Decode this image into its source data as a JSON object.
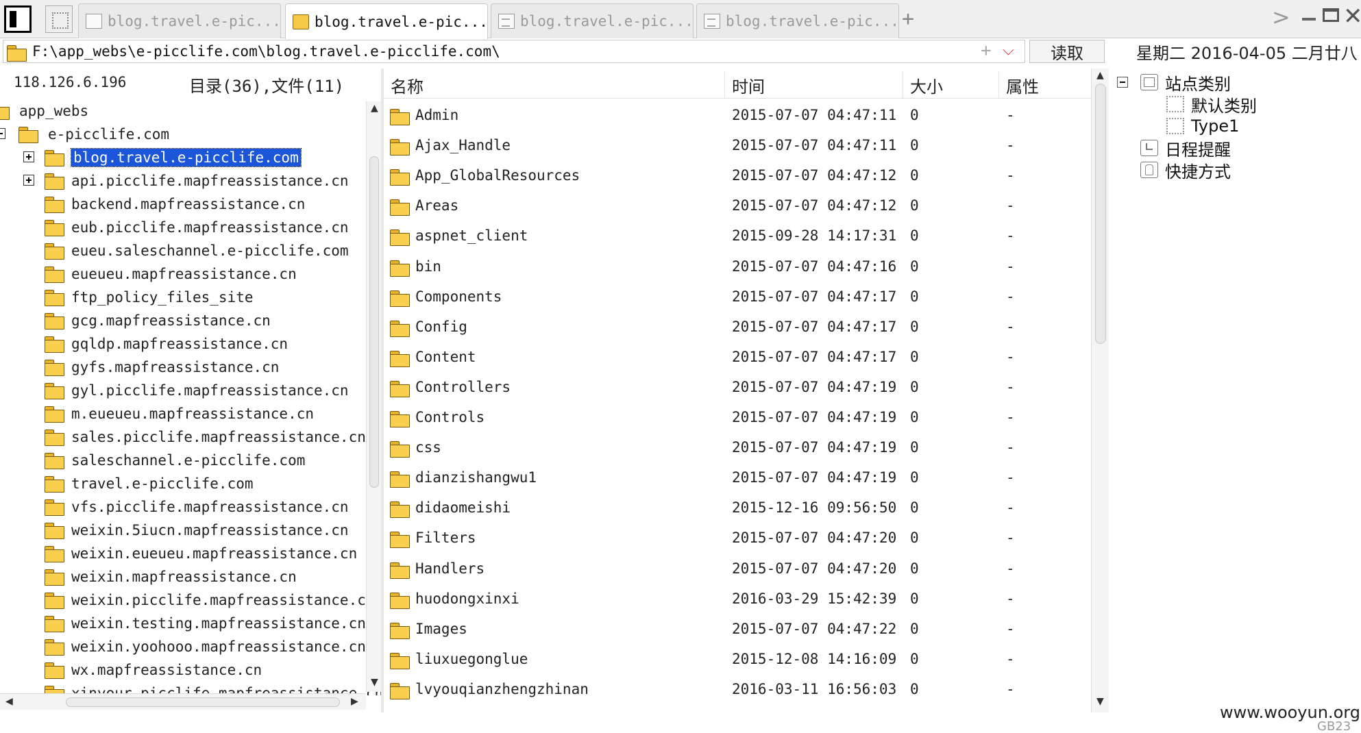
{
  "tabs": [
    {
      "label": "blog.travel.e-pic...",
      "icon": "page-icon",
      "active": false
    },
    {
      "label": "blog.travel.e-pic...",
      "icon": "folder-icon",
      "active": true
    },
    {
      "label": "blog.travel.e-pic...",
      "icon": "document-icon",
      "active": false
    },
    {
      "label": "blog.travel.e-pic...",
      "icon": "document-icon",
      "active": false
    }
  ],
  "toolbar": {
    "add_tab": "+",
    "scroll_tabs": ">",
    "address": "F:\\app_webs\\e-picclife.com\\blog.travel.e-picclife.com\\",
    "address_add": "+",
    "address_dropdown": "⌵",
    "read_button": "读取"
  },
  "window_controls": {
    "close": "✕"
  },
  "status": {
    "ip": "118.126.6.196",
    "dir_count": "目录(36),文件(11)"
  },
  "tree": {
    "root": "app_webs",
    "domain": "e-picclife.com",
    "items": [
      "blog.travel.e-picclife.com",
      "api.picclife.mapfreassistance.cn",
      "backend.mapfreassistance.cn",
      "eub.picclife.mapfreassistance.cn",
      "eueu.saleschannel.e-picclife.com",
      "eueueu.mapfreassistance.cn",
      "ftp_policy_files_site",
      "gcg.mapfreassistance.cn",
      "gqldp.mapfreassistance.cn",
      "gyfs.mapfreassistance.cn",
      "gyl.picclife.mapfreassistance.cn",
      "m.eueueu.mapfreassistance.cn",
      "sales.picclife.mapfreassistance.cn",
      "saleschannel.e-picclife.com",
      "travel.e-picclife.com",
      "vfs.picclife.mapfreassistance.cn",
      "weixin.5iucn.mapfreassistance.cn",
      "weixin.eueueu.mapfreassistance.cn",
      "weixin.mapfreassistance.cn",
      "weixin.picclife.mapfreassistance.cn",
      "weixin.testing.mapfreassistance.cn",
      "weixin.yoohooo.mapfreassistance.cn",
      "wx.mapfreassistance.cn",
      "xinyour.picclife.mapfreassistance.cn"
    ]
  },
  "columns": {
    "name": "名称",
    "time": "时间",
    "size": "大小",
    "attr": "属性"
  },
  "files": [
    {
      "name": "Admin",
      "time": "2015-07-07 04:47:11",
      "size": "0",
      "attr": "-"
    },
    {
      "name": "Ajax_Handle",
      "time": "2015-07-07 04:47:11",
      "size": "0",
      "attr": "-"
    },
    {
      "name": "App_GlobalResources",
      "time": "2015-07-07 04:47:12",
      "size": "0",
      "attr": "-"
    },
    {
      "name": "Areas",
      "time": "2015-07-07 04:47:12",
      "size": "0",
      "attr": "-"
    },
    {
      "name": "aspnet_client",
      "time": "2015-09-28 14:17:31",
      "size": "0",
      "attr": "-"
    },
    {
      "name": "bin",
      "time": "2015-07-07 04:47:16",
      "size": "0",
      "attr": "-"
    },
    {
      "name": "Components",
      "time": "2015-07-07 04:47:17",
      "size": "0",
      "attr": "-"
    },
    {
      "name": "Config",
      "time": "2015-07-07 04:47:17",
      "size": "0",
      "attr": "-"
    },
    {
      "name": "Content",
      "time": "2015-07-07 04:47:17",
      "size": "0",
      "attr": "-"
    },
    {
      "name": "Controllers",
      "time": "2015-07-07 04:47:19",
      "size": "0",
      "attr": "-"
    },
    {
      "name": "Controls",
      "time": "2015-07-07 04:47:19",
      "size": "0",
      "attr": "-"
    },
    {
      "name": "css",
      "time": "2015-07-07 04:47:19",
      "size": "0",
      "attr": "-"
    },
    {
      "name": "dianzishangwu1",
      "time": "2015-07-07 04:47:19",
      "size": "0",
      "attr": "-"
    },
    {
      "name": "didaomeishi",
      "time": "2015-12-16 09:56:50",
      "size": "0",
      "attr": "-"
    },
    {
      "name": "Filters",
      "time": "2015-07-07 04:47:20",
      "size": "0",
      "attr": "-"
    },
    {
      "name": "Handlers",
      "time": "2015-07-07 04:47:20",
      "size": "0",
      "attr": "-"
    },
    {
      "name": "huodongxinxi",
      "time": "2016-03-29 15:42:39",
      "size": "0",
      "attr": "-"
    },
    {
      "name": "Images",
      "time": "2015-07-07 04:47:22",
      "size": "0",
      "attr": "-"
    },
    {
      "name": "liuxuegonglue",
      "time": "2015-12-08 14:16:09",
      "size": "0",
      "attr": "-"
    },
    {
      "name": "lvyouqianzhengzhinan",
      "time": "2016-03-11 16:56:03",
      "size": "0",
      "attr": "-"
    }
  ],
  "side_panel": {
    "date": "星期二 2016-04-05 二月廿八",
    "site_category": "站点类别",
    "default_category": "默认类别",
    "type1": "Type1",
    "schedule": "日程提醒",
    "shortcuts": "快捷方式"
  },
  "footer": {
    "watermark": "www.wooyun.org",
    "encoding": "GB23"
  },
  "colors": {
    "selection": "#1b55d9",
    "folder": "#f8cf4f",
    "accent_red": "#d33333"
  }
}
